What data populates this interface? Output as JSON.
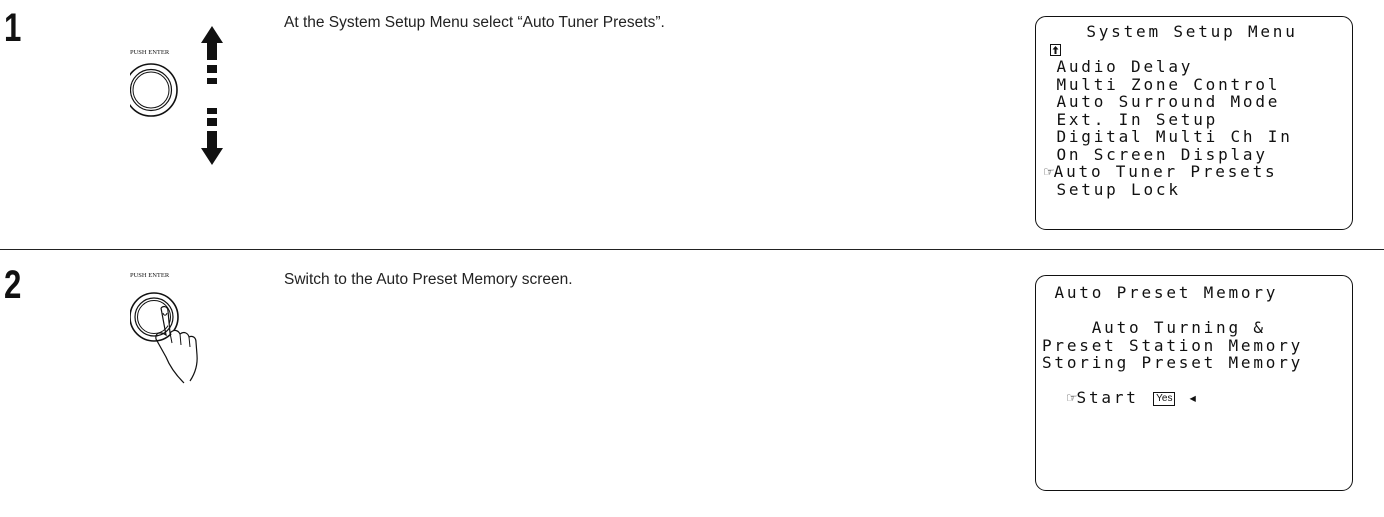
{
  "steps": [
    {
      "number": "1",
      "instruction": "At the System Setup Menu select “Auto Tuner Presets”.",
      "dial_label": "PUSH ENTER",
      "screen": {
        "title": "System Setup Menu",
        "scroll_icon": "up-arrow-box-icon",
        "items": [
          "Audio Delay",
          "Multi Zone Control",
          "Auto Surround Mode",
          "Ext. In Setup",
          "Digital Multi Ch In",
          "On Screen Display",
          "Auto Tuner Presets",
          "Setup Lock"
        ],
        "selected_item": "Auto Tuner Presets",
        "pointer_icon": "☞"
      }
    },
    {
      "number": "2",
      "instruction": "Switch to the Auto Preset Memory screen.",
      "dial_label": "PUSH ENTER",
      "screen": {
        "title": "Auto Preset Memory",
        "lines": [
          "Auto Turning &",
          "Preset Station Memory",
          "Storing Preset Memory"
        ],
        "pointer_icon": "☞",
        "start_label": "Start",
        "option_value": "Yes",
        "cursor_icon": "◂"
      }
    }
  ]
}
